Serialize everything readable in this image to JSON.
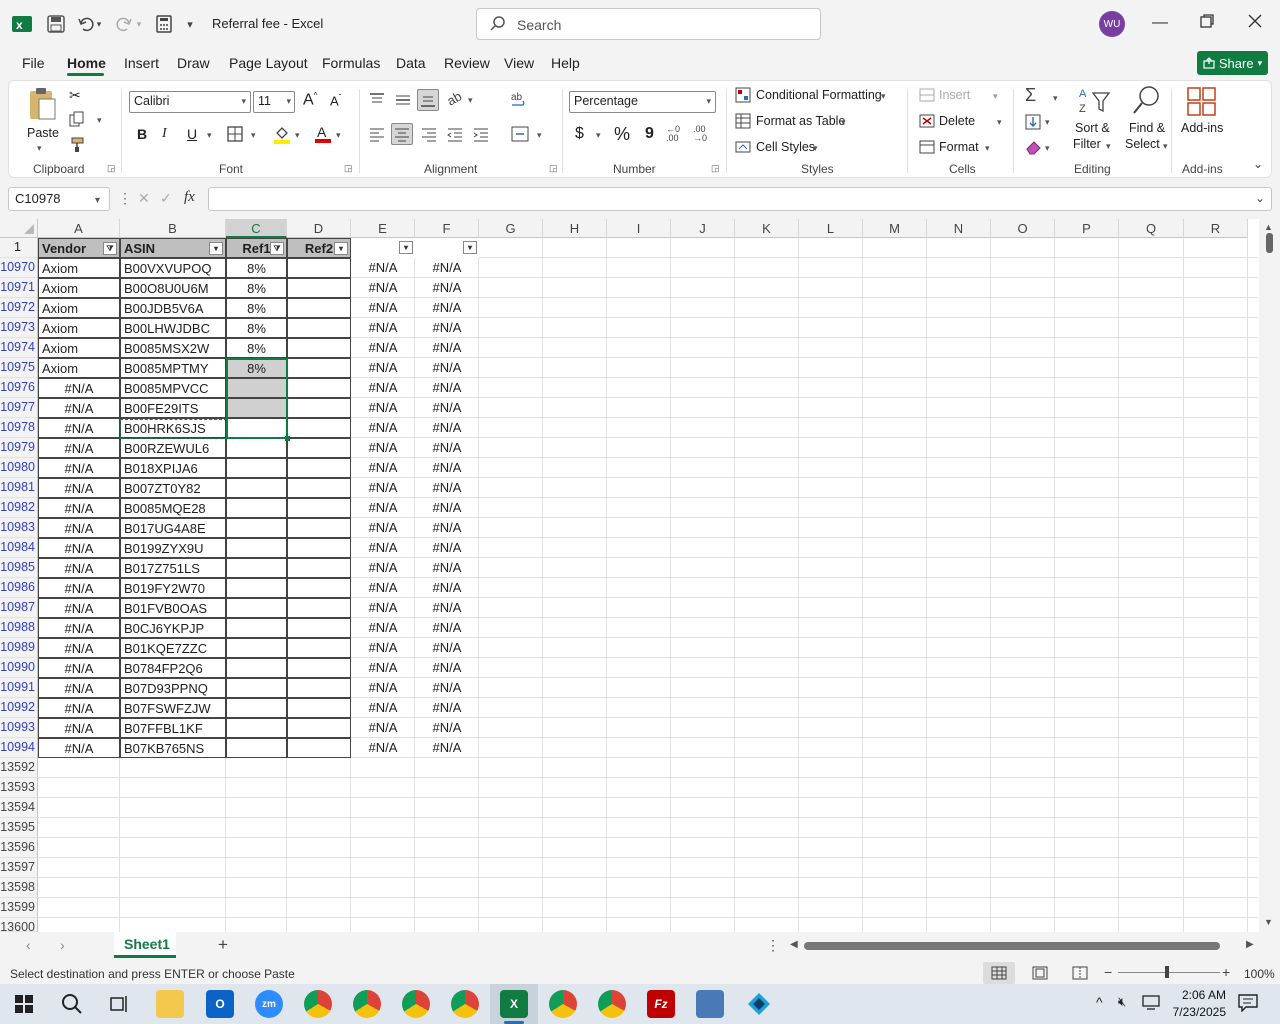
{
  "title_bar": {
    "doc_title": "Referral fee  -  Excel",
    "search_placeholder": "Search",
    "avatar_initials": "WU"
  },
  "menu": {
    "tabs": [
      "File",
      "Home",
      "Insert",
      "Draw",
      "Page Layout",
      "Formulas",
      "Data",
      "Review",
      "View",
      "Help"
    ],
    "active_tab": "Home",
    "share_label": "Share"
  },
  "ribbon": {
    "clipboard": {
      "paste_label": "Paste",
      "group_label": "Clipboard"
    },
    "font": {
      "font_name": "Calibri",
      "font_size": "11",
      "group_label": "Font",
      "bold": "B",
      "italic": "I",
      "underline": "U"
    },
    "alignment": {
      "group_label": "Alignment"
    },
    "number": {
      "format": "Percentage",
      "group_label": "Number",
      "currency": "$",
      "percent": "%",
      "comma": "9"
    },
    "styles": {
      "conditional_formatting": "Conditional Formatting",
      "format_as_table": "Format as Table",
      "cell_styles": "Cell Styles",
      "group_label": "Styles"
    },
    "cells": {
      "insert": "Insert",
      "delete": "Delete",
      "format": "Format",
      "group_label": "Cells"
    },
    "editing": {
      "sort_filter_1": "Sort &",
      "sort_filter_2": "Filter",
      "find_select_1": "Find &",
      "find_select_2": "Select",
      "group_label": "Editing"
    },
    "addins": {
      "label": "Add-ins",
      "group_label": "Add-ins"
    }
  },
  "formula_bar": {
    "name_box": "C10978",
    "fx": "fx",
    "formula": ""
  },
  "grid": {
    "columns": [
      "A",
      "B",
      "C",
      "D",
      "E",
      "F",
      "G",
      "H",
      "I",
      "J",
      "K",
      "L",
      "M",
      "N",
      "O",
      "P",
      "Q",
      "R"
    ],
    "header_row_number": "1",
    "headers": {
      "A": "Vendor",
      "B": "ASIN",
      "C": "Ref1",
      "D": "Ref2"
    },
    "rows": [
      {
        "n": "10970",
        "a": "Axiom",
        "b": "B00VXVUPOQ",
        "c": "8%",
        "e": "#N/A",
        "f": "#N/A"
      },
      {
        "n": "10971",
        "a": "Axiom",
        "b": "B00O8U0U6M",
        "c": "8%",
        "e": "#N/A",
        "f": "#N/A"
      },
      {
        "n": "10972",
        "a": "Axiom",
        "b": "B00JDB5V6A",
        "c": "8%",
        "e": "#N/A",
        "f": "#N/A"
      },
      {
        "n": "10973",
        "a": "Axiom",
        "b": "B00LHWJDBC",
        "c": "8%",
        "e": "#N/A",
        "f": "#N/A"
      },
      {
        "n": "10974",
        "a": "Axiom",
        "b": "B0085MSX2W",
        "c": "8%",
        "e": "#N/A",
        "f": "#N/A"
      },
      {
        "n": "10975",
        "a": "Axiom",
        "b": "B0085MPTMY",
        "c": "8%",
        "e": "#N/A",
        "f": "#N/A"
      },
      {
        "n": "10976",
        "a": "#N/A",
        "b": "B0085MPVCC",
        "c": "",
        "e": "#N/A",
        "f": "#N/A"
      },
      {
        "n": "10977",
        "a": "#N/A",
        "b": "B00FE29ITS",
        "c": "",
        "e": "#N/A",
        "f": "#N/A"
      },
      {
        "n": "10978",
        "a": "#N/A",
        "b": "B00HRK6SJS",
        "c": "",
        "e": "#N/A",
        "f": "#N/A"
      },
      {
        "n": "10979",
        "a": "#N/A",
        "b": "B00RZEWUL6",
        "c": "",
        "e": "#N/A",
        "f": "#N/A"
      },
      {
        "n": "10980",
        "a": "#N/A",
        "b": "B018XPIJA6",
        "c": "",
        "e": "#N/A",
        "f": "#N/A"
      },
      {
        "n": "10981",
        "a": "#N/A",
        "b": "B007ZT0Y82",
        "c": "",
        "e": "#N/A",
        "f": "#N/A"
      },
      {
        "n": "10982",
        "a": "#N/A",
        "b": "B0085MQE28",
        "c": "",
        "e": "#N/A",
        "f": "#N/A"
      },
      {
        "n": "10983",
        "a": "#N/A",
        "b": "B017UG4A8E",
        "c": "",
        "e": "#N/A",
        "f": "#N/A"
      },
      {
        "n": "10984",
        "a": "#N/A",
        "b": "B0199ZYX9U",
        "c": "",
        "e": "#N/A",
        "f": "#N/A"
      },
      {
        "n": "10985",
        "a": "#N/A",
        "b": "B017Z751LS",
        "c": "",
        "e": "#N/A",
        "f": "#N/A"
      },
      {
        "n": "10986",
        "a": "#N/A",
        "b": "B019FY2W70",
        "c": "",
        "e": "#N/A",
        "f": "#N/A"
      },
      {
        "n": "10987",
        "a": "#N/A",
        "b": "B01FVB0OAS",
        "c": "",
        "e": "#N/A",
        "f": "#N/A"
      },
      {
        "n": "10988",
        "a": "#N/A",
        "b": "B0CJ6YKPJP",
        "c": "",
        "e": "#N/A",
        "f": "#N/A"
      },
      {
        "n": "10989",
        "a": "#N/A",
        "b": "B01KQE7ZZC",
        "c": "",
        "e": "#N/A",
        "f": "#N/A"
      },
      {
        "n": "10990",
        "a": "#N/A",
        "b": "B0784FP2Q6",
        "c": "",
        "e": "#N/A",
        "f": "#N/A"
      },
      {
        "n": "10991",
        "a": "#N/A",
        "b": "B07D93PPNQ",
        "c": "",
        "e": "#N/A",
        "f": "#N/A"
      },
      {
        "n": "10992",
        "a": "#N/A",
        "b": "B07FSWFZJW",
        "c": "",
        "e": "#N/A",
        "f": "#N/A"
      },
      {
        "n": "10993",
        "a": "#N/A",
        "b": "B07FFBL1KF",
        "c": "",
        "e": "#N/A",
        "f": "#N/A"
      },
      {
        "n": "10994",
        "a": "#N/A",
        "b": "B07KB765NS",
        "c": "",
        "e": "#N/A",
        "f": "#N/A"
      }
    ],
    "empty_rows": [
      "13592",
      "13593",
      "13594",
      "13595",
      "13596",
      "13597",
      "13598",
      "13599",
      "13600"
    ]
  },
  "sheet_tabs": {
    "active": "Sheet1"
  },
  "status_bar": {
    "message": "Select destination and press ENTER or choose Paste",
    "zoom": "100%"
  },
  "taskbar": {
    "time": "2:06 AM",
    "date": "7/23/2025"
  },
  "colors": {
    "excel_green": "#107c41",
    "filtered_row_blue": "#2f3fc6",
    "selection_gray": "#d0d0d0"
  }
}
